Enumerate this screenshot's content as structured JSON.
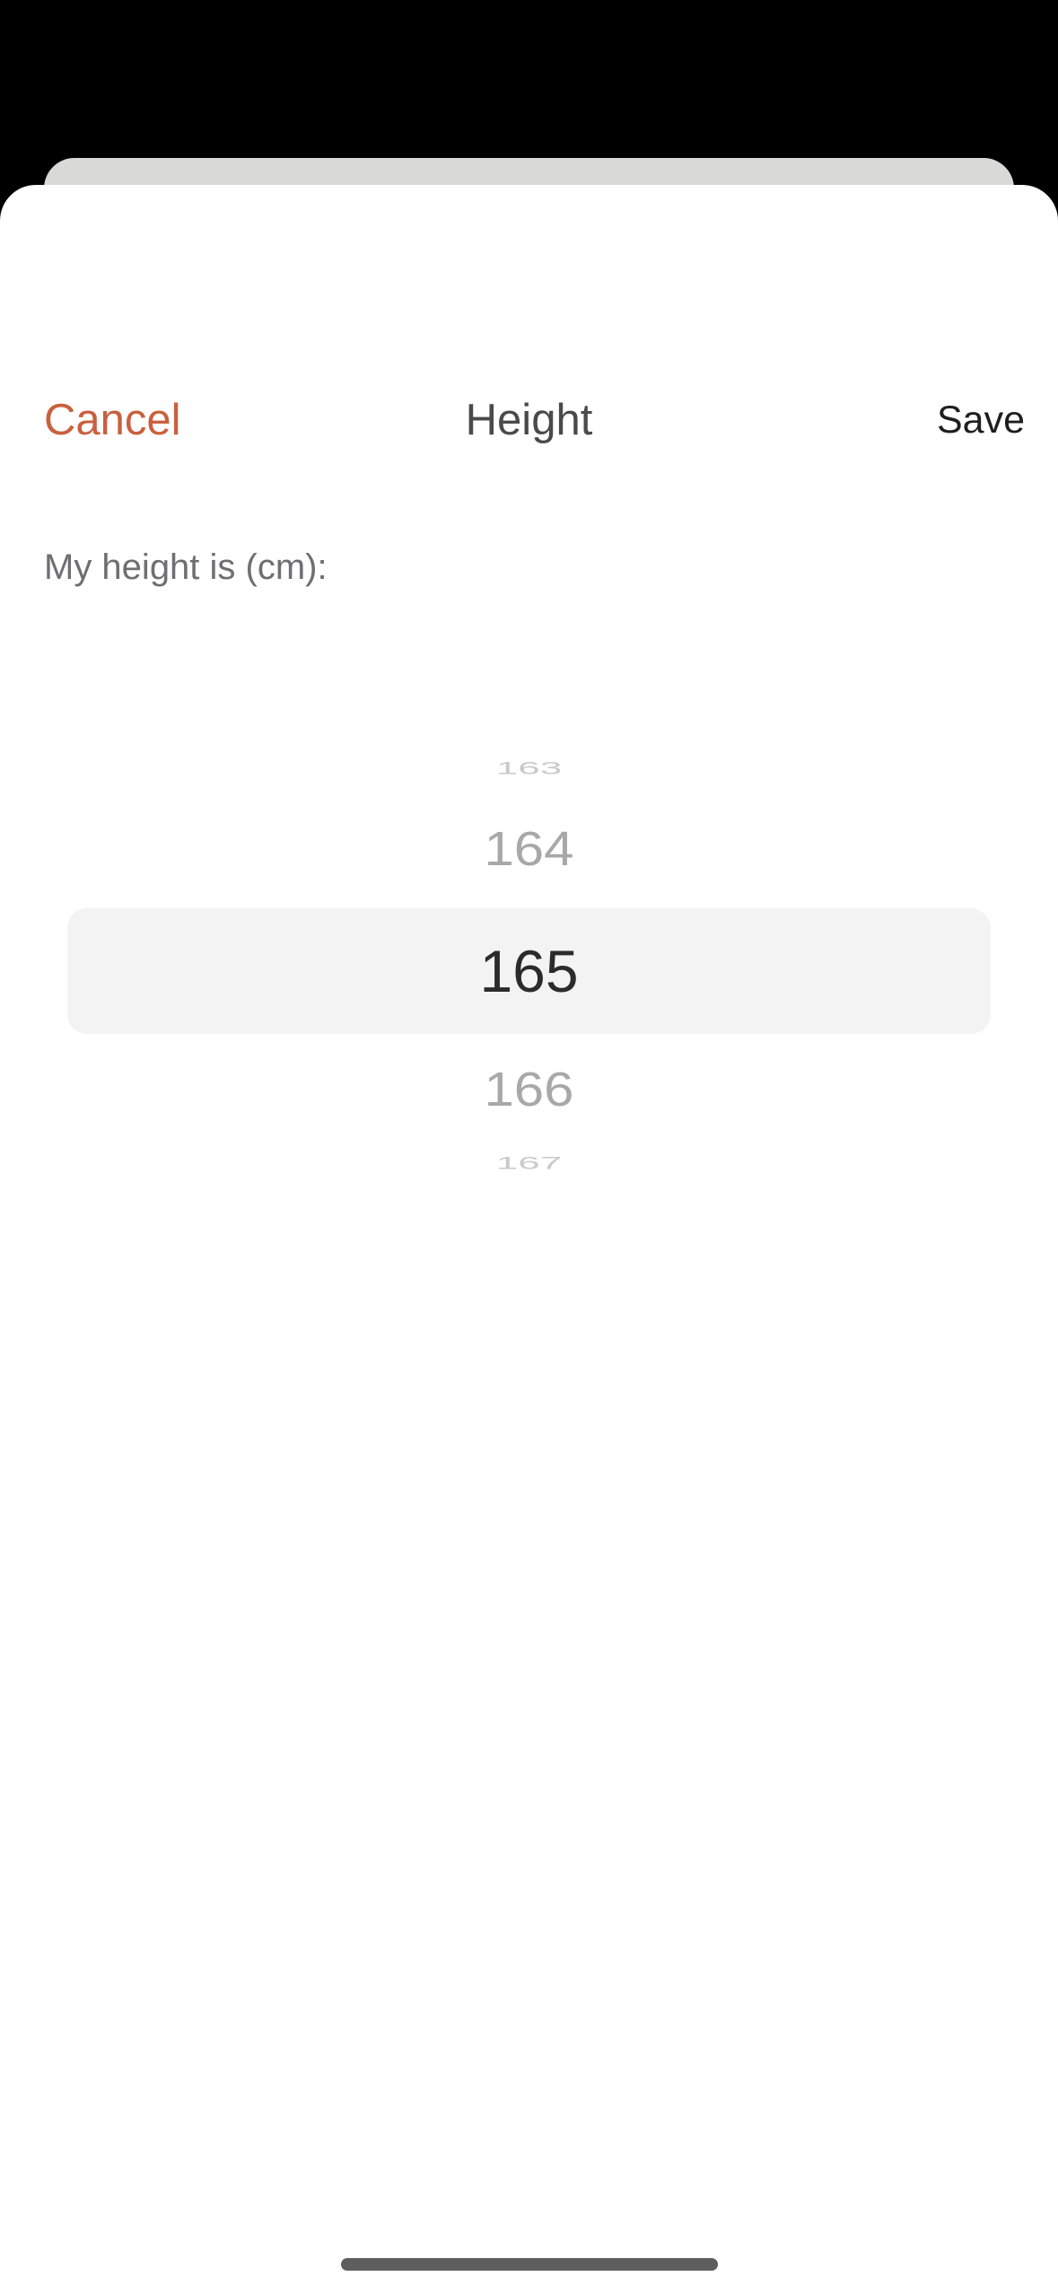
{
  "header": {
    "cancel_label": "Cancel",
    "title": "Height",
    "save_label": "Save"
  },
  "form": {
    "prompt": "My height is (cm):"
  },
  "picker": {
    "unit": "cm",
    "selected_value": 165,
    "visible_values": [
      "163",
      "164",
      "165",
      "166",
      "167"
    ],
    "selected_label": "165"
  },
  "colors": {
    "accent": "#c9603d",
    "backdrop": "#000000",
    "sheet": "#ffffff",
    "selection_highlight": "#f3f3f3"
  }
}
